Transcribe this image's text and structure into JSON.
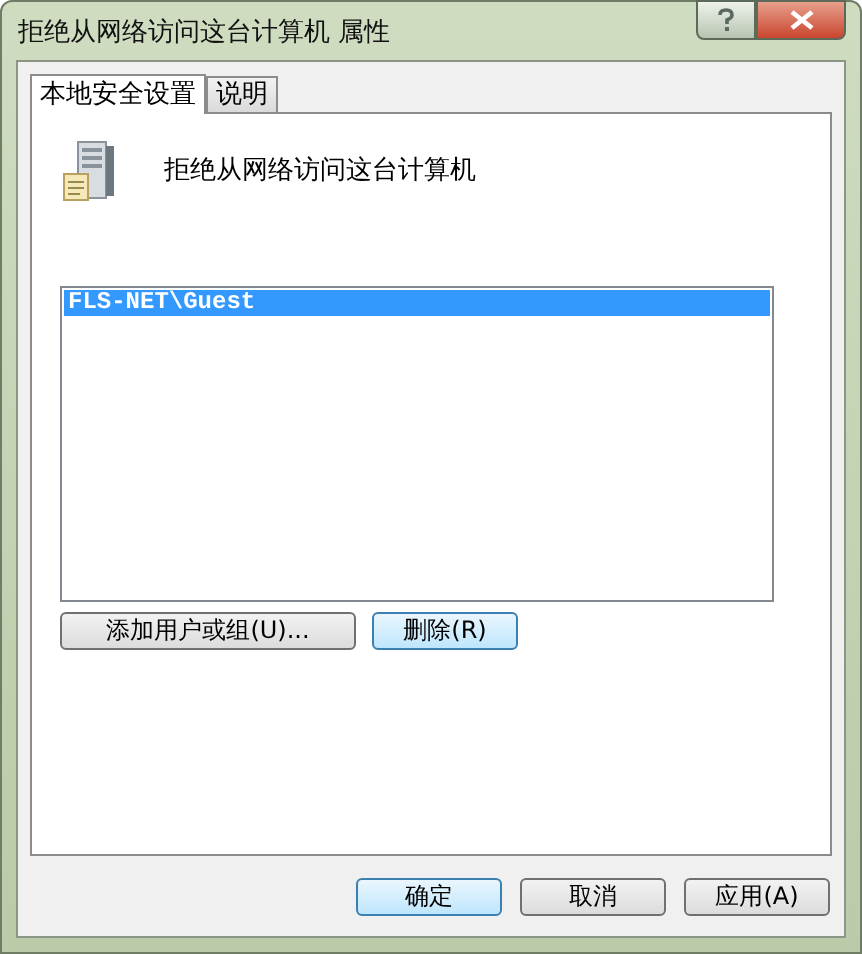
{
  "window": {
    "title": "拒绝从网络访问这台计算机 属性"
  },
  "tabs": [
    {
      "label": "本地安全设置",
      "selected": true
    },
    {
      "label": "说明",
      "selected": false
    }
  ],
  "policy": {
    "name": "拒绝从网络访问这台计算机"
  },
  "list": [
    {
      "label": "FLS-NET\\Guest",
      "selected": true
    }
  ],
  "list_buttons": [
    {
      "label": "添加用户或组(U)...",
      "focused": false
    },
    {
      "label": "删除(R)",
      "focused": true
    }
  ],
  "dialog_buttons": [
    {
      "label": "确定",
      "focused": true
    },
    {
      "label": "取消",
      "focused": false
    },
    {
      "label": "应用(A)",
      "focused": false
    }
  ]
}
